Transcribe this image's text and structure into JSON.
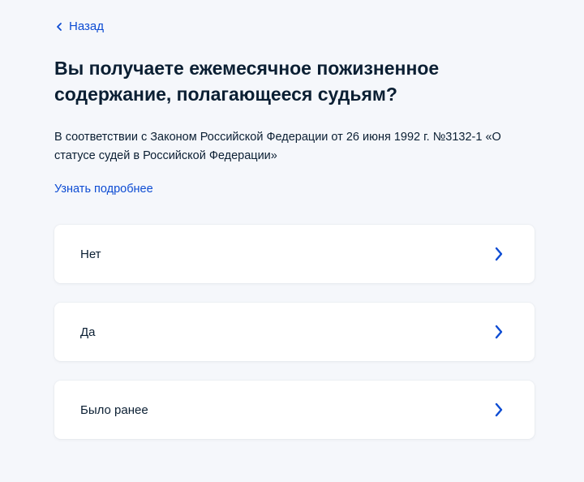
{
  "nav": {
    "back_label": "Назад"
  },
  "question": {
    "title": "Вы получаете ежемесячное пожизненное содержание, полагающееся судьям?",
    "description": "В соответствии с Законом Российской Федерации от 26 июня 1992 г. №3132-1 «О статусе судей в Российской Федерации»",
    "more_link": "Узнать подробнее"
  },
  "options": [
    {
      "label": "Нет"
    },
    {
      "label": "Да"
    },
    {
      "label": "Было ранее"
    }
  ],
  "colors": {
    "background": "#f5f7fb",
    "card": "#ffffff",
    "accent": "#0d4cd3",
    "text": "#0b1f33"
  },
  "icons": {
    "back": "chevron-left-icon",
    "option_arrow": "chevron-right-icon"
  }
}
